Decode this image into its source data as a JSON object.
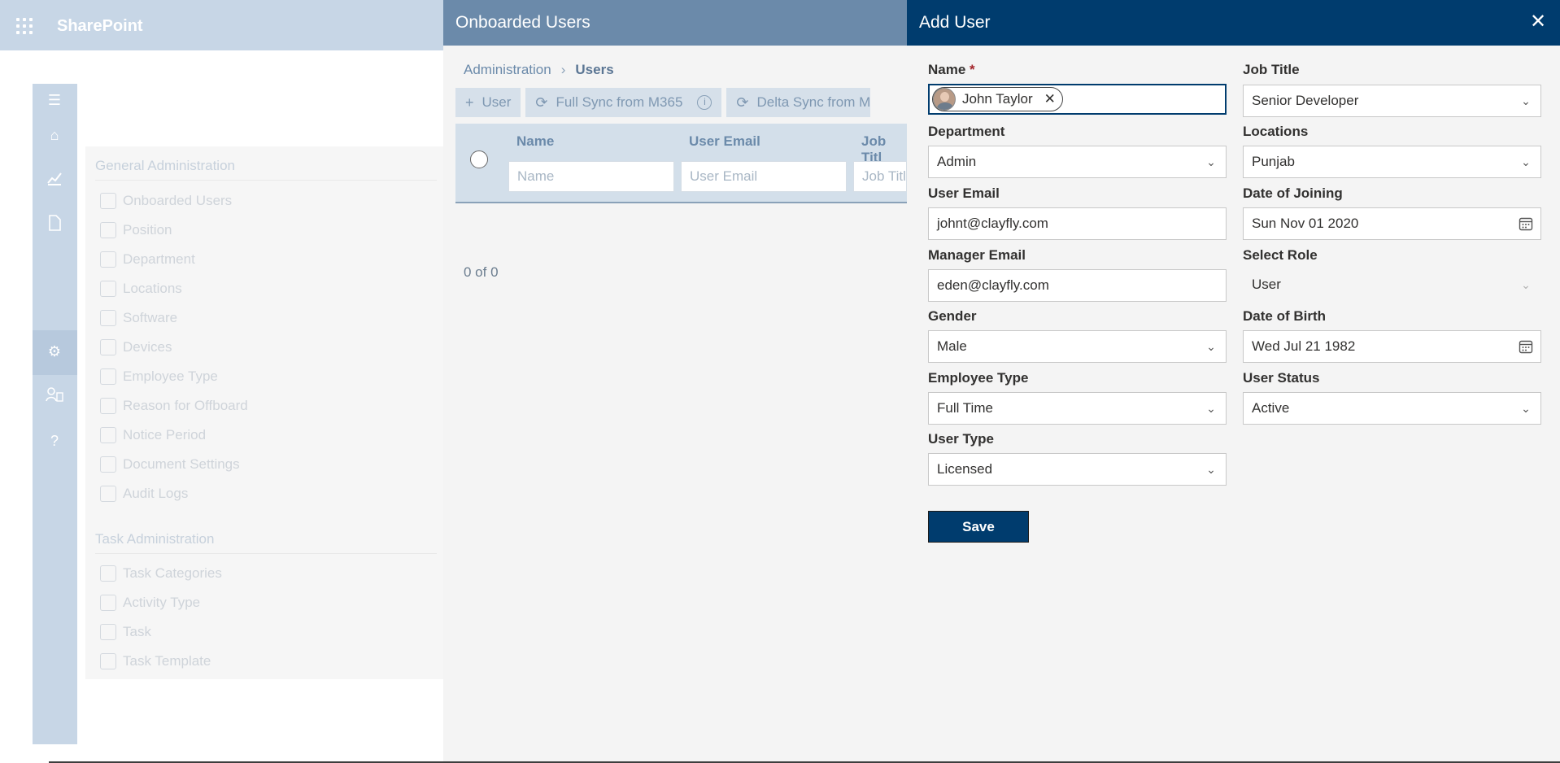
{
  "app": {
    "title": "SharePoint"
  },
  "nav": {
    "general_title": "General Administration",
    "general_items": [
      "Onboarded Users",
      "Position",
      "Department",
      "Locations",
      "Software",
      "Devices",
      "Employee Type",
      "Reason for Offboard",
      "Notice Period",
      "Document Settings",
      "Audit Logs"
    ],
    "task_title": "Task Administration",
    "task_items": [
      "Task Categories",
      "Activity Type",
      "Task",
      "Task Template"
    ]
  },
  "users_panel": {
    "title": "Onboarded Users",
    "breadcrumb": {
      "parent": "Administration",
      "current": "Users"
    },
    "toolbar": {
      "add_user": "User",
      "full_sync": "Full Sync from M365",
      "delta_sync": "Delta Sync from M"
    },
    "columns": [
      {
        "label": "Name",
        "filter_placeholder": "Name"
      },
      {
        "label": "User Email",
        "filter_placeholder": "User Email"
      },
      {
        "label": "Job Titl",
        "filter_placeholder": "Job Titl"
      }
    ],
    "pager": "0 of 0"
  },
  "dialog": {
    "title": "Add User",
    "fields": {
      "name": {
        "label": "Name",
        "required_mark": "*",
        "persona": "John Taylor"
      },
      "job_title": {
        "label": "Job Title",
        "value": "Senior Developer"
      },
      "department": {
        "label": "Department",
        "value": "Admin"
      },
      "locations": {
        "label": "Locations",
        "value": "Punjab"
      },
      "user_email": {
        "label": "User Email",
        "value": "johnt@clayfly.com"
      },
      "date_of_joining": {
        "label": "Date of Joining",
        "value": "Sun Nov 01 2020"
      },
      "manager_email": {
        "label": "Manager Email",
        "value": "eden@clayfly.com"
      },
      "select_role": {
        "label": "Select Role",
        "value": "User"
      },
      "gender": {
        "label": "Gender",
        "value": "Male"
      },
      "date_of_birth": {
        "label": "Date of Birth",
        "value": "Wed Jul 21 1982"
      },
      "employee_type": {
        "label": "Employee Type",
        "value": "Full Time"
      },
      "user_status": {
        "label": "User Status",
        "value": "Active"
      },
      "user_type": {
        "label": "User Type",
        "value": "Licensed"
      }
    },
    "save_label": "Save"
  },
  "colors": {
    "primary": "#003c6e",
    "panel_header": "#6b8aaa",
    "suite_bar": "#c7d6e6"
  },
  "icons": [
    "waffle-icon",
    "hamburger-icon",
    "home-icon",
    "chart-icon",
    "document-icon",
    "gear-icon",
    "people-icon",
    "help-icon",
    "plus-icon",
    "sync-icon",
    "info-icon",
    "close-icon",
    "chevron-down-icon",
    "calendar-icon"
  ]
}
